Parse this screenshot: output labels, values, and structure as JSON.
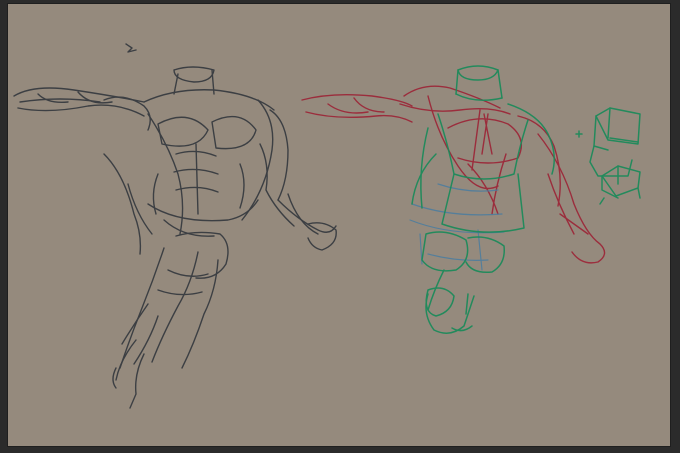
{
  "colors": {
    "window_bg": "#2b2b2b",
    "canvas_bg": "#958a7d",
    "sketch_dark": "#35393f",
    "sketch_red": "#9c2336",
    "sketch_green": "#1a8a5a",
    "sketch_blue": "#4a7da0"
  }
}
